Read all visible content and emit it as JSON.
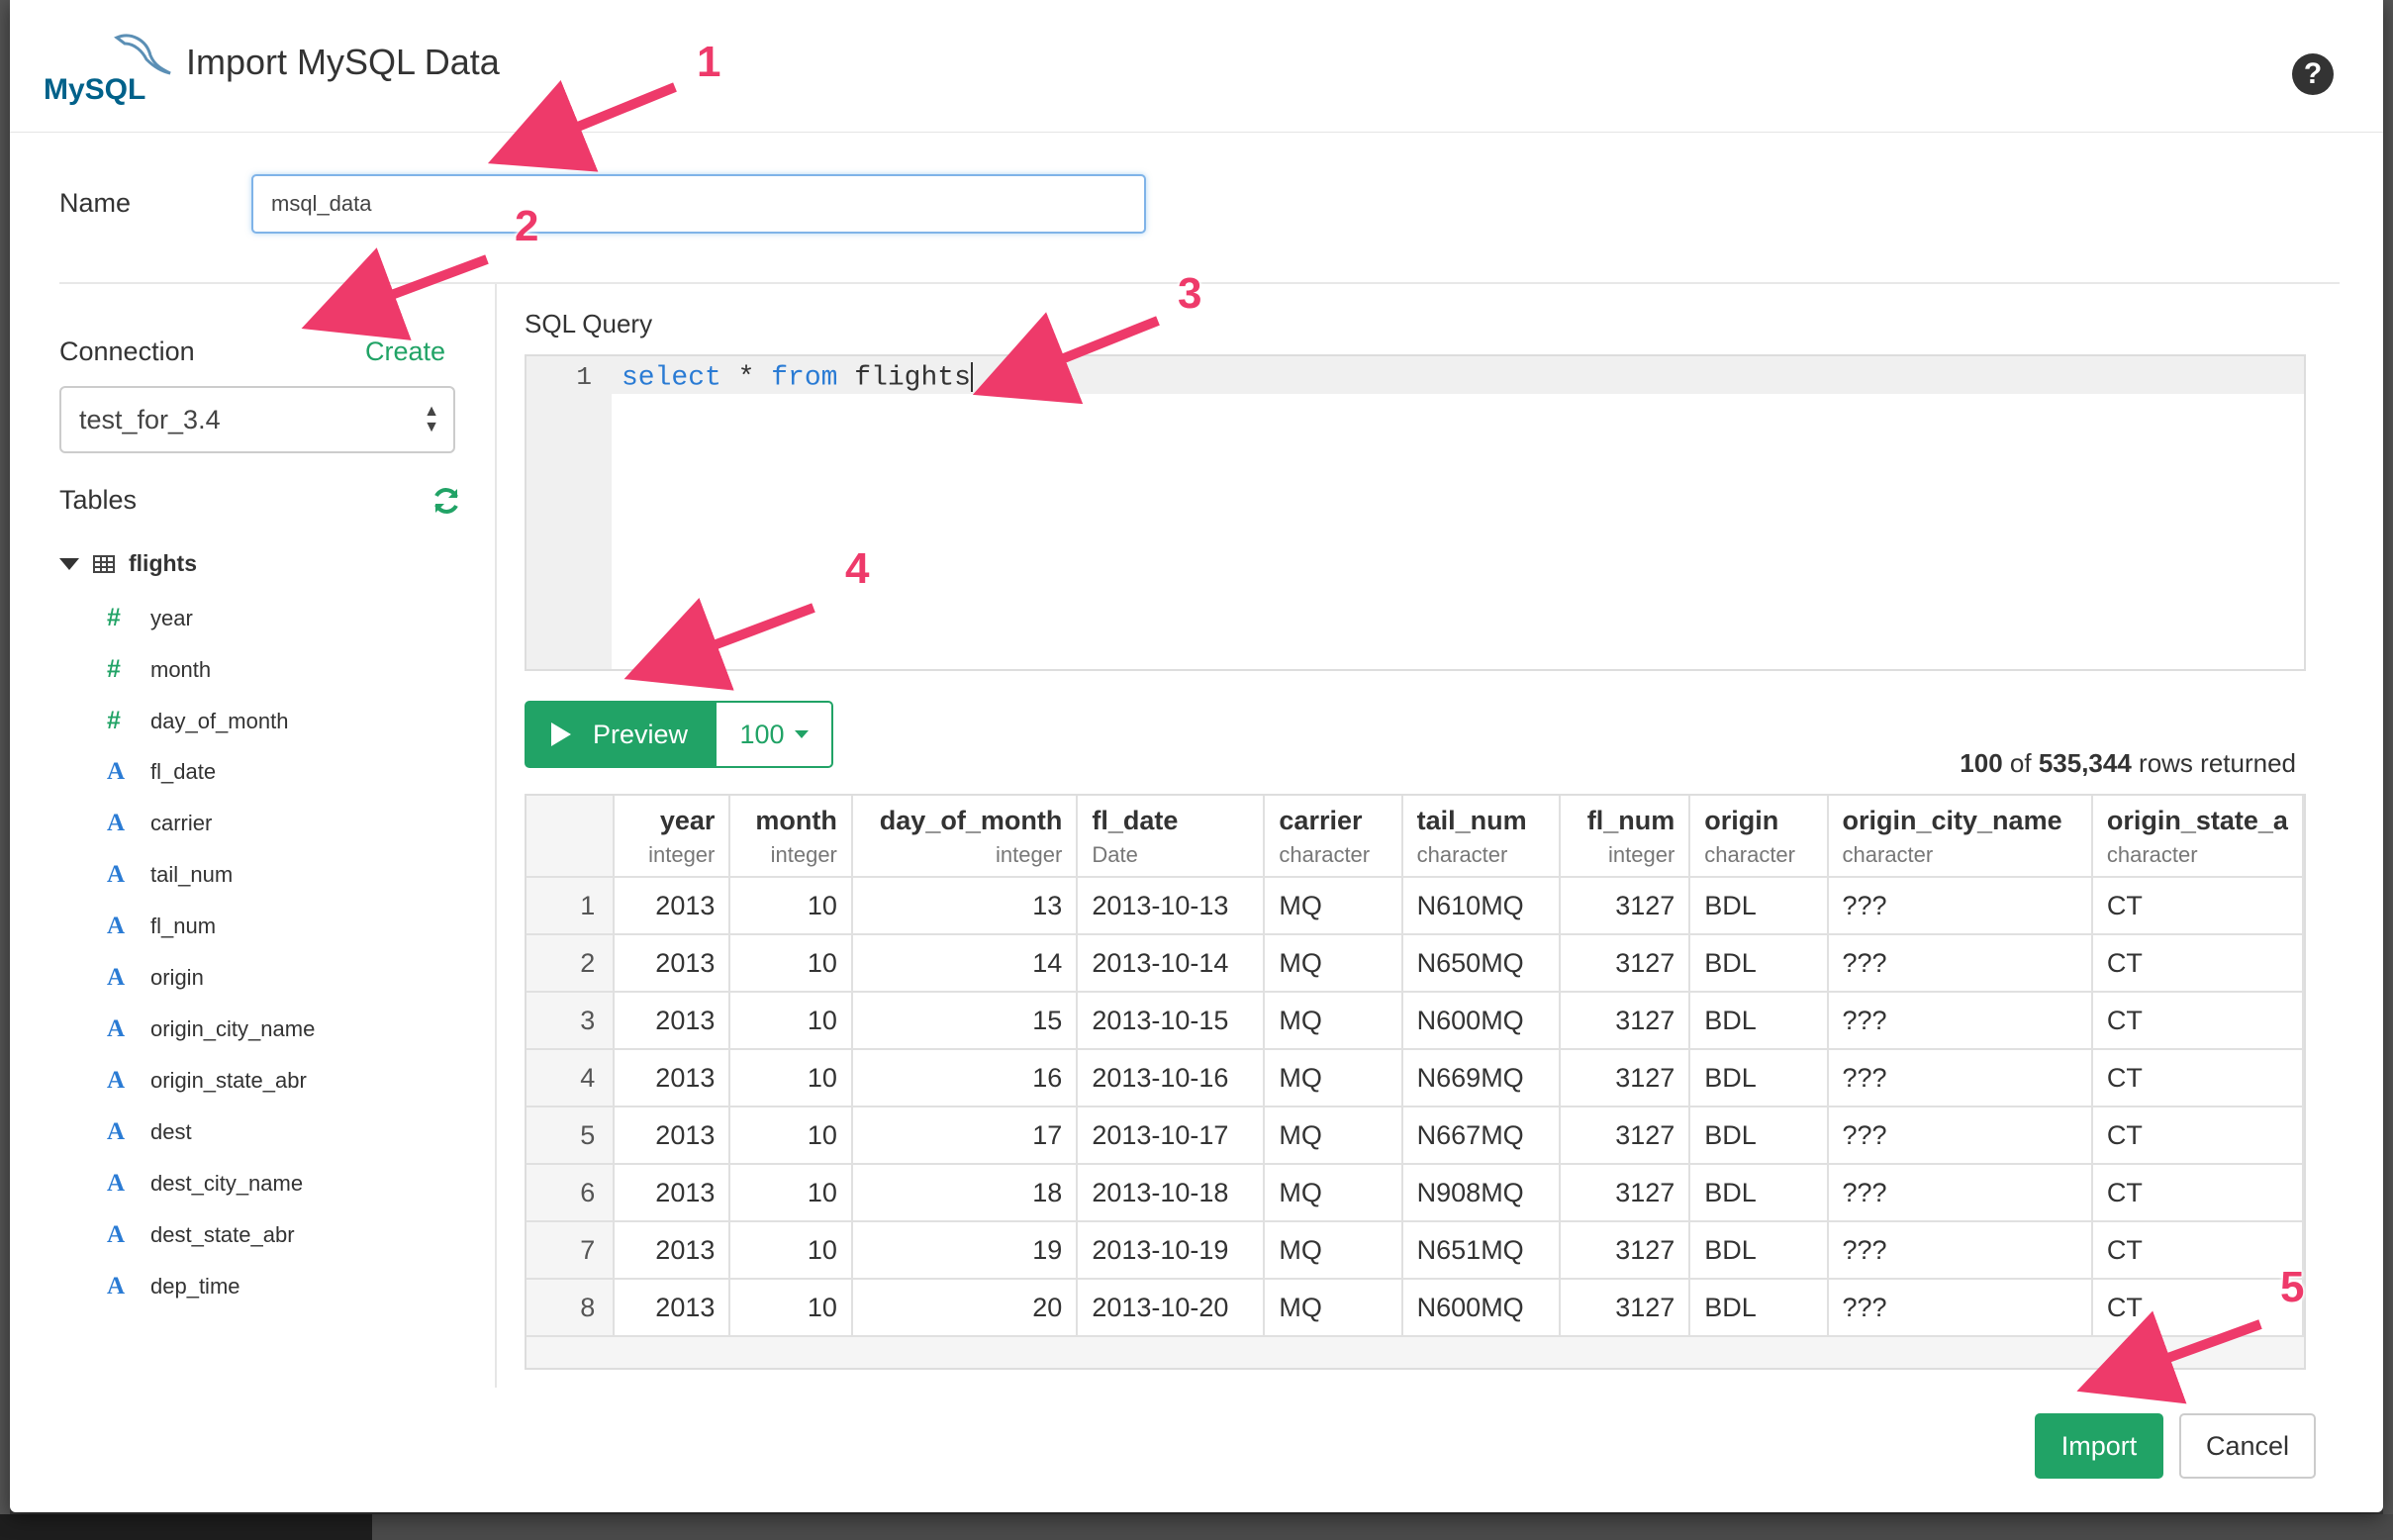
{
  "header": {
    "logo_text": "MySQL",
    "title": "Import MySQL Data",
    "help_label": "?"
  },
  "name_field": {
    "label": "Name",
    "value": "msql_data"
  },
  "connection": {
    "label": "Connection",
    "create_label": "Create",
    "selected": "test_for_3.4"
  },
  "tables": {
    "label": "Tables",
    "table_name": "flights",
    "columns": [
      {
        "name": "year",
        "kind": "num",
        "icon": "#"
      },
      {
        "name": "month",
        "kind": "num",
        "icon": "#"
      },
      {
        "name": "day_of_month",
        "kind": "num",
        "icon": "#"
      },
      {
        "name": "fl_date",
        "kind": "str",
        "icon": "A"
      },
      {
        "name": "carrier",
        "kind": "str",
        "icon": "A"
      },
      {
        "name": "tail_num",
        "kind": "str",
        "icon": "A"
      },
      {
        "name": "fl_num",
        "kind": "str",
        "icon": "A"
      },
      {
        "name": "origin",
        "kind": "str",
        "icon": "A"
      },
      {
        "name": "origin_city_name",
        "kind": "str",
        "icon": "A"
      },
      {
        "name": "origin_state_abr",
        "kind": "str",
        "icon": "A"
      },
      {
        "name": "dest",
        "kind": "str",
        "icon": "A"
      },
      {
        "name": "dest_city_name",
        "kind": "str",
        "icon": "A"
      },
      {
        "name": "dest_state_abr",
        "kind": "str",
        "icon": "A"
      },
      {
        "name": "dep_time",
        "kind": "str",
        "icon": "A"
      }
    ]
  },
  "sql": {
    "label": "SQL Query",
    "line_number": "1",
    "keyword1": "select",
    "middle": " * ",
    "keyword2": "from",
    "rest": " flights"
  },
  "preview": {
    "button_label": "Preview",
    "rows_label": "100"
  },
  "result": {
    "shown": "100",
    "of": " of ",
    "total": "535,344",
    "suffix": " rows returned"
  },
  "grid": {
    "columns": [
      {
        "name": "year",
        "type": "integer",
        "align": "num"
      },
      {
        "name": "month",
        "type": "integer",
        "align": "num"
      },
      {
        "name": "day_of_month",
        "type": "integer",
        "align": "num"
      },
      {
        "name": "fl_date",
        "type": "Date",
        "align": "str"
      },
      {
        "name": "carrier",
        "type": "character",
        "align": "str"
      },
      {
        "name": "tail_num",
        "type": "character",
        "align": "str"
      },
      {
        "name": "fl_num",
        "type": "integer",
        "align": "num"
      },
      {
        "name": "origin",
        "type": "character",
        "align": "str"
      },
      {
        "name": "origin_city_name",
        "type": "character",
        "align": "str"
      },
      {
        "name": "origin_state_a",
        "type": "character",
        "align": "str"
      }
    ],
    "rows": [
      [
        "1",
        "2013",
        "10",
        "13",
        "2013-10-13",
        "MQ",
        "N610MQ",
        "3127",
        "BDL",
        "???",
        "CT"
      ],
      [
        "2",
        "2013",
        "10",
        "14",
        "2013-10-14",
        "MQ",
        "N650MQ",
        "3127",
        "BDL",
        "???",
        "CT"
      ],
      [
        "3",
        "2013",
        "10",
        "15",
        "2013-10-15",
        "MQ",
        "N600MQ",
        "3127",
        "BDL",
        "???",
        "CT"
      ],
      [
        "4",
        "2013",
        "10",
        "16",
        "2013-10-16",
        "MQ",
        "N669MQ",
        "3127",
        "BDL",
        "???",
        "CT"
      ],
      [
        "5",
        "2013",
        "10",
        "17",
        "2013-10-17",
        "MQ",
        "N667MQ",
        "3127",
        "BDL",
        "???",
        "CT"
      ],
      [
        "6",
        "2013",
        "10",
        "18",
        "2013-10-18",
        "MQ",
        "N908MQ",
        "3127",
        "BDL",
        "???",
        "CT"
      ],
      [
        "7",
        "2013",
        "10",
        "19",
        "2013-10-19",
        "MQ",
        "N651MQ",
        "3127",
        "BDL",
        "???",
        "CT"
      ],
      [
        "8",
        "2013",
        "10",
        "20",
        "2013-10-20",
        "MQ",
        "N600MQ",
        "3127",
        "BDL",
        "???",
        "CT"
      ]
    ]
  },
  "footer": {
    "import_label": "Import",
    "cancel_label": "Cancel"
  },
  "annotations": [
    "1",
    "2",
    "3",
    "4",
    "5"
  ],
  "colors": {
    "accent": "#21a366",
    "arrow": "#ee3a6a",
    "type_icon": "#2a7bd4"
  }
}
